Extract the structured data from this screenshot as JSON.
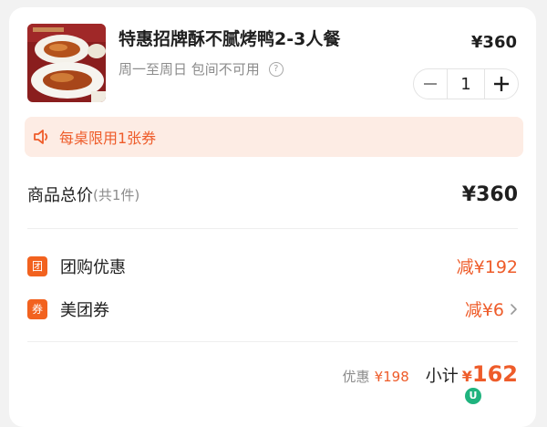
{
  "product": {
    "title": "特惠招牌酥不腻烤鸭2-3人餐",
    "availability": "周一至周日 包间不可用",
    "help_icon": "question-circle-icon",
    "price": "¥360",
    "quantity": "1"
  },
  "notice": {
    "icon": "speaker-icon",
    "text": "每桌限用1张券"
  },
  "total": {
    "label": "商品总价",
    "count": "(共1件)",
    "price": "¥360"
  },
  "discounts": [
    {
      "tag": "团",
      "label": "团购优惠",
      "value": "减¥192"
    },
    {
      "tag": "券",
      "label": "美团券",
      "value": "减¥6"
    }
  ],
  "footer": {
    "saved_label": "优惠",
    "saved_value": "¥198",
    "subtotal_label": "小计",
    "subtotal_currency": "¥",
    "subtotal_value": "162"
  },
  "badge": {
    "text": "U"
  },
  "colors": {
    "accent": "#ee5c2a",
    "tag_bg": "#f2621f",
    "notice_bg": "#fdece4",
    "badge": "#1fb37e"
  }
}
